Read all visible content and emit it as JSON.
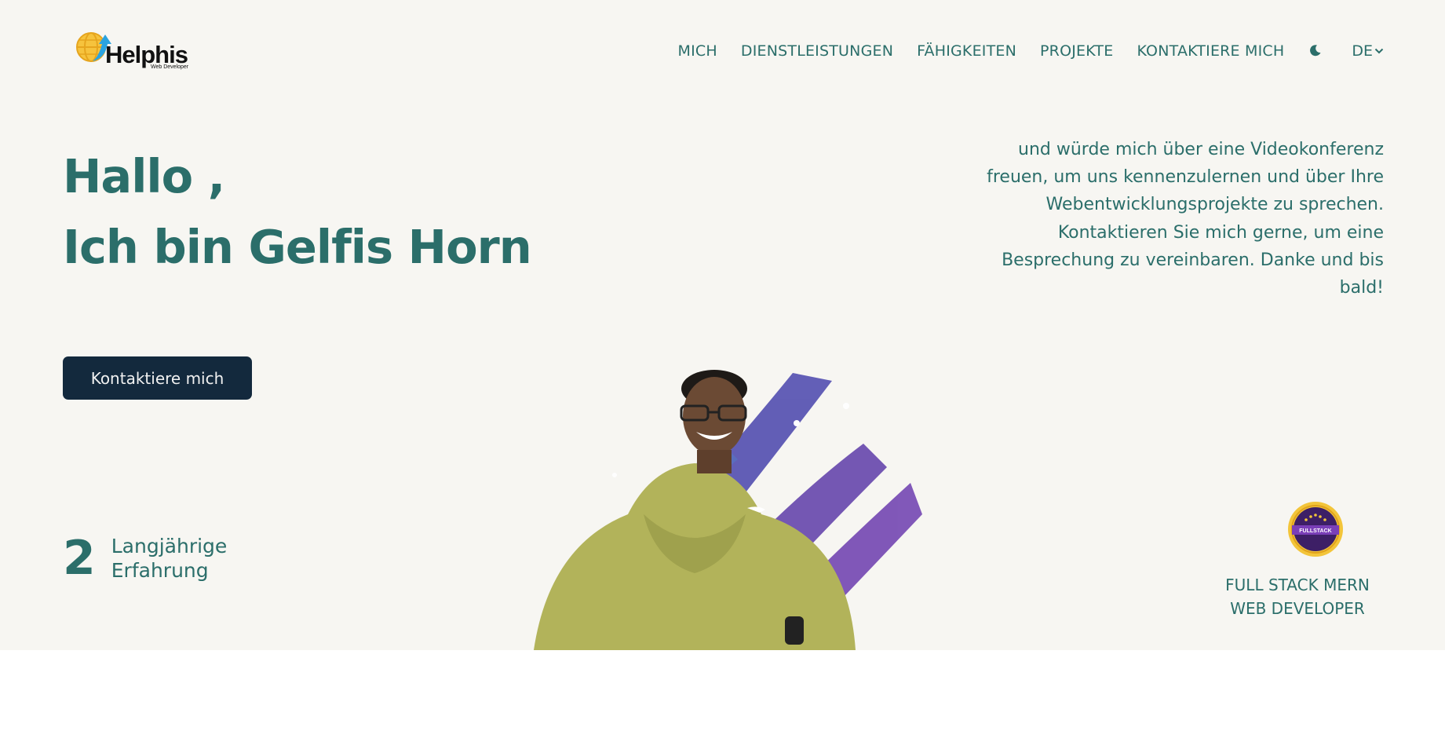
{
  "brand": {
    "name": "Helphis",
    "tagline": "Web Developer"
  },
  "nav": {
    "links": [
      "MICH",
      "DIENSTLEISTUNGEN",
      "FÄHIGKEITEN",
      "PROJEKTE",
      "KONTAKTIERE MICH"
    ],
    "theme_icon": "moon-icon",
    "language": "DE"
  },
  "hero": {
    "greeting_line1": "Hallo ,",
    "greeting_line2": "Ich bin Gelfis Horn",
    "intro": "und würde mich über eine Videokonferenz freuen, um uns kennenzulernen und über Ihre Webentwicklungsprojekte zu sprechen. Kontaktieren Sie mich gerne, um eine Besprechung zu vereinbaren. Danke und bis bald!",
    "cta_label": "Kontaktiere mich",
    "experience": {
      "number": "2",
      "label_line1": "Langjährige",
      "label_line2": "Erfahrung"
    },
    "badge_label": "FULLSTACK",
    "role_line1": "FULL STACK MERN",
    "role_line2": "WEB DEVELOPER"
  },
  "colors": {
    "accent": "#2b6e6a",
    "button": "#13293d",
    "background": "#f7f6f2",
    "brush": "#6a4fb3"
  }
}
